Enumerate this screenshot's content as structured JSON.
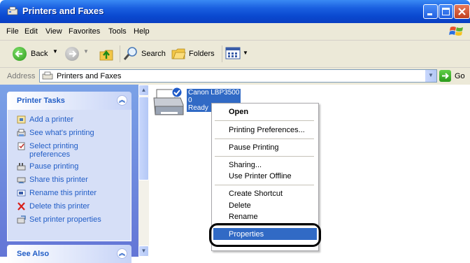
{
  "window": {
    "title": "Printers and Faxes"
  },
  "menu": [
    "File",
    "Edit",
    "View",
    "Favorites",
    "Tools",
    "Help"
  ],
  "toolbar": {
    "back": "Back",
    "search": "Search",
    "folders": "Folders"
  },
  "address": {
    "label": "Address",
    "value": "Printers and Faxes",
    "go": "Go"
  },
  "sidebar": {
    "printer_tasks": {
      "title": "Printer Tasks",
      "items": [
        {
          "label": "Add a printer",
          "icon": "add-printer-icon"
        },
        {
          "label": "See what's printing",
          "icon": "print-queue-icon"
        },
        {
          "label": "Select printing preferences",
          "icon": "preferences-icon"
        },
        {
          "label": "Pause printing",
          "icon": "pause-icon"
        },
        {
          "label": "Share this printer",
          "icon": "share-icon"
        },
        {
          "label": "Rename this printer",
          "icon": "rename-icon"
        },
        {
          "label": "Delete this printer",
          "icon": "delete-icon"
        },
        {
          "label": "Set printer properties",
          "icon": "properties-icon"
        }
      ]
    },
    "see_also": {
      "title": "See Also"
    }
  },
  "printer": {
    "name": "Canon LBP3500",
    "jobs": "0",
    "status": "Ready"
  },
  "context_menu": {
    "open": "Open",
    "printing_preferences": "Printing Preferences...",
    "pause_printing": "Pause Printing",
    "sharing": "Sharing...",
    "use_offline": "Use Printer Offline",
    "create_shortcut": "Create Shortcut",
    "delete": "Delete",
    "rename": "Rename",
    "properties": "Properties"
  },
  "colors": {
    "title_blue": "#0a49d0",
    "task_link": "#215dc6",
    "selection": "#316ac5",
    "sidebar": "#7ba2e7"
  }
}
